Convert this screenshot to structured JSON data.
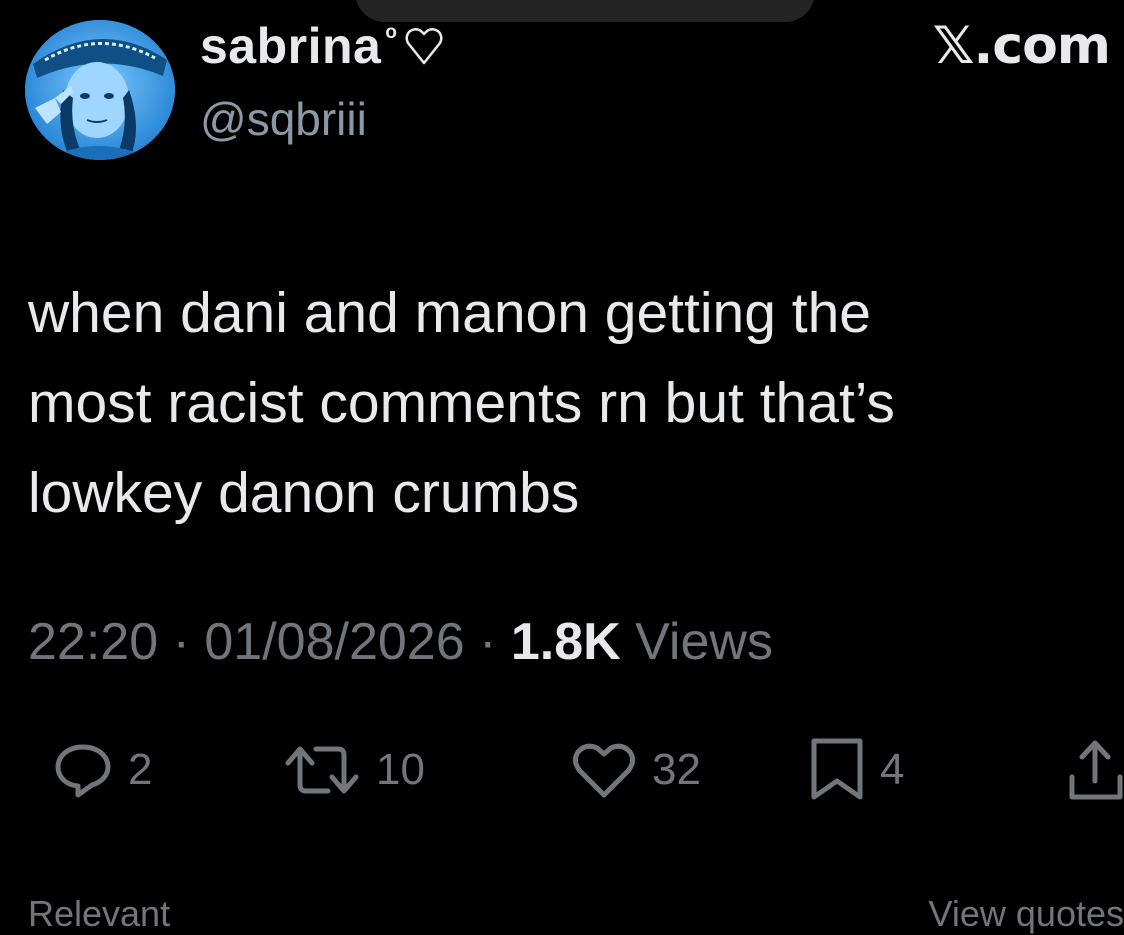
{
  "post": {
    "author": {
      "display_name": "sabrina",
      "name_suffix": "ᵒ",
      "handle": "@sqbriii",
      "avatar_icon": "profile-photo"
    },
    "brand": "𝕏.com",
    "text_lines": [
      "when dani and manon getting the",
      "most racist comments rn but that’s",
      "lowkey danon crumbs"
    ],
    "meta": {
      "time": "22:20",
      "separator": "·",
      "date": "01/08/2026",
      "views_count": "1.8K",
      "views_label": "Views"
    },
    "actions": {
      "replies": "2",
      "reposts": "10",
      "likes": "32",
      "bookmarks": "4"
    },
    "bottom": {
      "left": "Relevant",
      "right": "View quotes"
    }
  },
  "colors": {
    "background": "#000000",
    "text_primary": "#e7e9ea",
    "text_secondary": "#71767b",
    "avatar_tint": "#3a9ee6"
  }
}
